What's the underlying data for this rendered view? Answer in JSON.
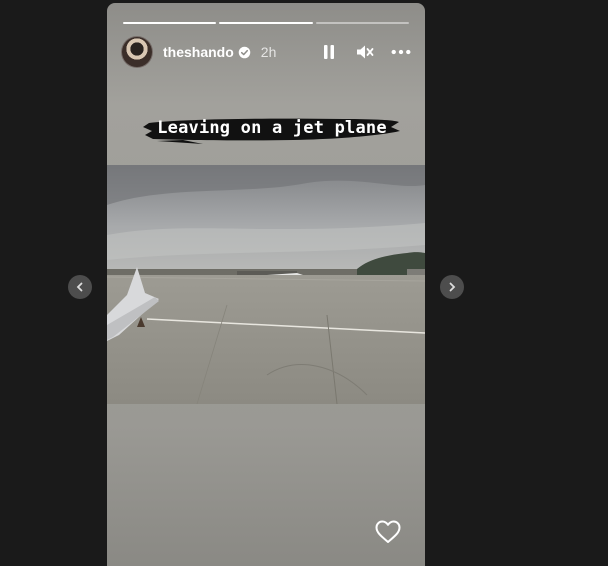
{
  "story": {
    "username": "theshando",
    "time_ago": "2h",
    "caption": "Leaving on a jet plane",
    "progress": [
      1,
      1,
      0
    ],
    "photo_subject": "airport tarmac seen from airplane window with wing"
  },
  "icons": {
    "verified": "verified-badge-icon",
    "pause": "pause-icon",
    "mute": "muted-speaker-icon",
    "more": "more-options-icon",
    "like": "heart-icon",
    "prev": "chevron-left-icon",
    "next": "chevron-right-icon"
  },
  "colors": {
    "background": "#1a1a1a",
    "nav_button": "#4d4d4d",
    "accent": "#ffffff"
  }
}
